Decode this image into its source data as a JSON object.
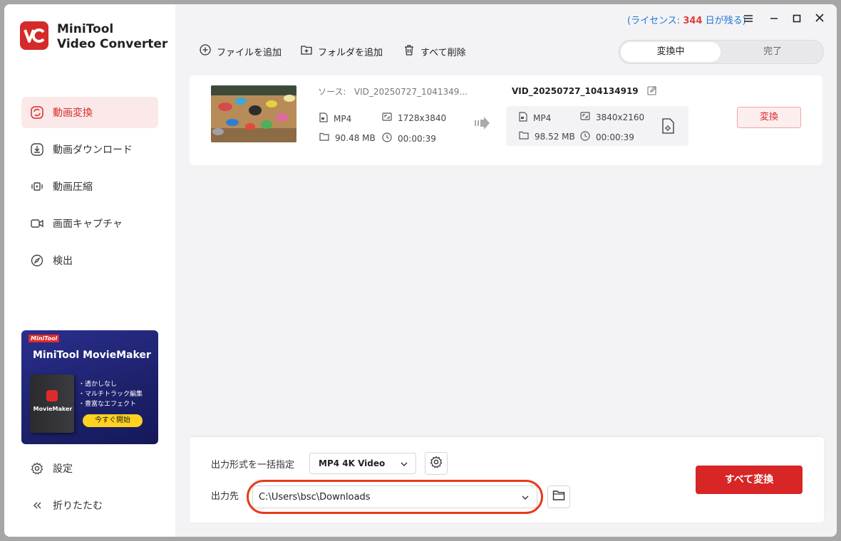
{
  "app": {
    "brand_line1": "MiniTool",
    "brand_line2": "Video Converter"
  },
  "sidebar": {
    "items": [
      {
        "label": "動画変換",
        "icon": "refresh-icon",
        "active": true
      },
      {
        "label": "動画ダウンロード",
        "icon": "download-icon",
        "active": false
      },
      {
        "label": "動画圧縮",
        "icon": "compress-icon",
        "active": false
      },
      {
        "label": "画面キャプチャ",
        "icon": "camera-icon",
        "active": false
      },
      {
        "label": "検出",
        "icon": "compass-icon",
        "active": false
      }
    ],
    "settings_label": "設定",
    "collapse_label": "折りたたむ"
  },
  "promo": {
    "tag": "MiniTool",
    "title": "MiniTool MovieMaker",
    "box_label": "MovieMaker",
    "features": [
      "・透かしなし",
      "・マルチトラック編集",
      "・豊富なエフェクト"
    ],
    "button": "今すぐ開始"
  },
  "header": {
    "license_prefix": "(ライセンス: ",
    "license_days": "344",
    "license_suffix": " 日が残る)",
    "add_file": "ファイルを追加",
    "add_folder": "フォルダを追加",
    "delete_all": "すべて削除",
    "tab_converting": "変換中",
    "tab_done": "完了"
  },
  "task": {
    "source_label": "ソース:",
    "source_name": "VID_20250727_1041349...",
    "source_format": "MP4",
    "source_resolution": "1728x3840",
    "source_size": "90.48 MB",
    "source_duration": "00:00:39",
    "output_name": "VID_20250727_104134919",
    "output_format": "MP4",
    "output_resolution": "3840x2160",
    "output_size": "98.52 MB",
    "output_duration": "00:00:39",
    "convert_button": "変換"
  },
  "bottom": {
    "format_label": "出力形式を一括指定",
    "format_value": "MP4 4K Video",
    "dest_label": "出力先",
    "dest_value": "C:\\Users\\bsc\\Downloads",
    "convert_all": "すべて変換"
  },
  "colors": {
    "accent": "#d82525",
    "license_blue": "#1e78d6",
    "highlight": "#e83a1c"
  }
}
